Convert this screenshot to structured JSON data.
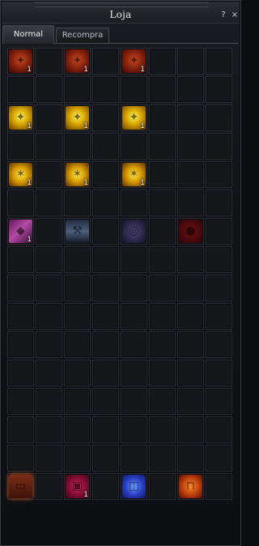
{
  "window": {
    "title": "Loja",
    "help_label": "?",
    "close_label": "×"
  },
  "tabs": [
    {
      "label": "Normal",
      "active": true
    },
    {
      "label": "Recompra",
      "active": false
    }
  ],
  "grid": {
    "columns": 8,
    "rows": 16,
    "items": [
      {
        "row": 0,
        "col": 0,
        "icon": "red-claw-icon",
        "style": "red-claw",
        "glyph": "✦",
        "qty": "1"
      },
      {
        "row": 0,
        "col": 2,
        "icon": "red-claw-icon",
        "style": "red-claw",
        "glyph": "✦",
        "qty": "1"
      },
      {
        "row": 0,
        "col": 4,
        "icon": "red-claw-icon",
        "style": "red-claw",
        "glyph": "✦",
        "qty": "1"
      },
      {
        "row": 2,
        "col": 0,
        "icon": "gold-claw-icon",
        "style": "gold-claw",
        "glyph": "✦",
        "qty": "1"
      },
      {
        "row": 2,
        "col": 2,
        "icon": "gold-claw-icon",
        "style": "gold-claw",
        "glyph": "✦",
        "qty": "1"
      },
      {
        "row": 2,
        "col": 4,
        "icon": "gold-claw-icon",
        "style": "gold-claw",
        "glyph": "✦",
        "qty": "1"
      },
      {
        "row": 4,
        "col": 0,
        "icon": "gold-moth-icon",
        "style": "gold-moth",
        "glyph": "✶",
        "qty": "1"
      },
      {
        "row": 4,
        "col": 2,
        "icon": "gold-moth-icon",
        "style": "gold-moth",
        "glyph": "✶",
        "qty": "1"
      },
      {
        "row": 4,
        "col": 4,
        "icon": "gold-moth-icon",
        "style": "gold-moth",
        "glyph": "✶",
        "qty": "1"
      },
      {
        "row": 6,
        "col": 0,
        "icon": "pink-crystal-icon",
        "style": "crystal",
        "glyph": "◆",
        "qty": "1"
      },
      {
        "row": 6,
        "col": 2,
        "icon": "anvil-icon",
        "style": "anvil",
        "glyph": "⚒",
        "qty": ""
      },
      {
        "row": 6,
        "col": 4,
        "icon": "chain-spring-icon",
        "style": "spring",
        "glyph": "◎",
        "qty": ""
      },
      {
        "row": 6,
        "col": 6,
        "icon": "dark-orb-icon",
        "style": "dark-red",
        "glyph": "●",
        "qty": ""
      },
      {
        "row": 15,
        "col": 0,
        "icon": "treasure-chest-icon",
        "style": "chest",
        "glyph": "▭",
        "qty": ""
      },
      {
        "row": 15,
        "col": 2,
        "icon": "pink-box-icon",
        "style": "pink-box",
        "glyph": "▣",
        "qty": "1"
      },
      {
        "row": 15,
        "col": 4,
        "icon": "blue-gift-icon",
        "style": "blue-gift",
        "glyph": "◫",
        "qty": ""
      },
      {
        "row": 15,
        "col": 6,
        "icon": "orange-gate-icon",
        "style": "orange-gate",
        "glyph": "⊓",
        "qty": ""
      }
    ]
  }
}
